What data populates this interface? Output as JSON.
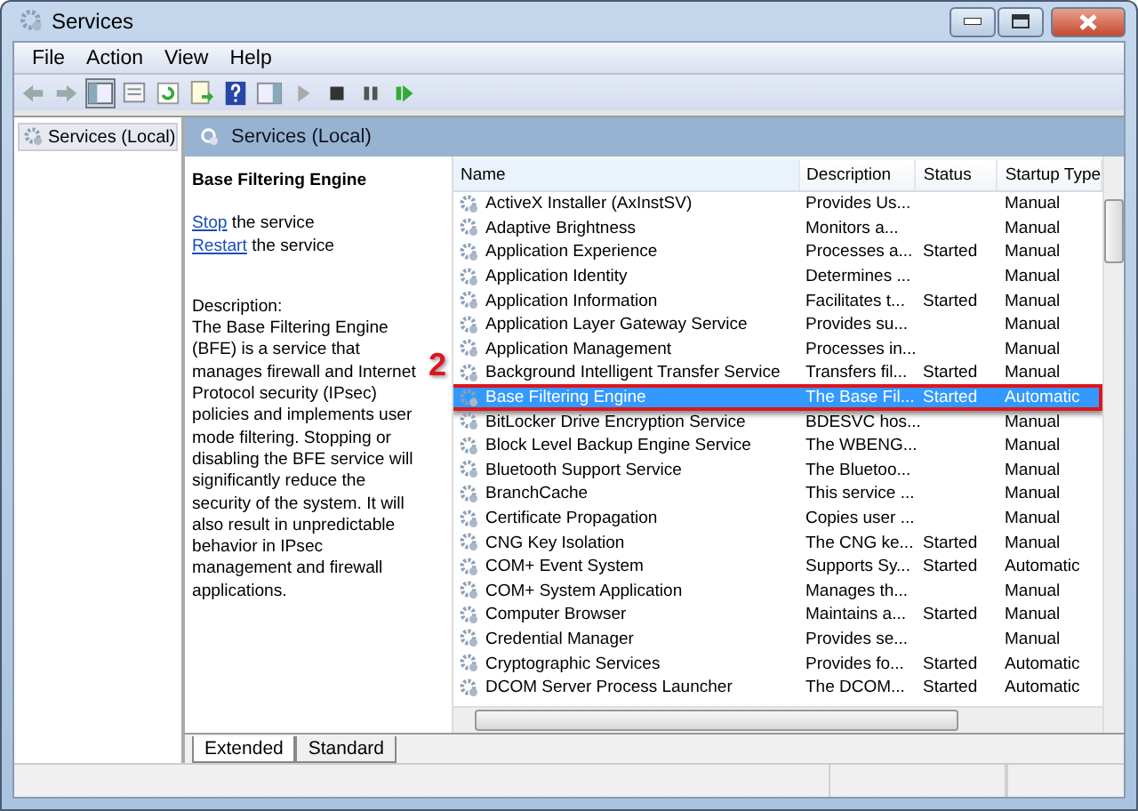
{
  "window": {
    "title": "Services"
  },
  "menu": [
    "File",
    "Action",
    "View",
    "Help"
  ],
  "tree": {
    "items": [
      {
        "label": "Services (Local)",
        "selected": true
      }
    ]
  },
  "pane_header": "Services (Local)",
  "details": {
    "title": "Base Filtering Engine",
    "actions": [
      {
        "link": "Stop",
        "text": "the service"
      },
      {
        "link": "Restart",
        "text": "the service"
      }
    ],
    "description_label": "Description:",
    "description": "The Base Filtering Engine (BFE) is a service that manages firewall and Internet Protocol security (IPsec) policies and implements user mode filtering. Stopping or disabling the BFE service will significantly reduce the security of the system. It will also result in unpredictable behavior in IPsec management and firewall applications."
  },
  "table": {
    "columns": [
      "Name",
      "Description",
      "Status",
      "Startup Type"
    ],
    "rows": [
      {
        "name": "ActiveX Installer (AxInstSV)",
        "description": "Provides Us...",
        "status": "",
        "startup": "Manual",
        "selected": false
      },
      {
        "name": "Adaptive Brightness",
        "description": "Monitors a...",
        "status": "",
        "startup": "Manual",
        "selected": false
      },
      {
        "name": "Application Experience",
        "description": "Processes a...",
        "status": "Started",
        "startup": "Manual",
        "selected": false
      },
      {
        "name": "Application Identity",
        "description": "Determines ...",
        "status": "",
        "startup": "Manual",
        "selected": false
      },
      {
        "name": "Application Information",
        "description": "Facilitates t...",
        "status": "Started",
        "startup": "Manual",
        "selected": false
      },
      {
        "name": "Application Layer Gateway Service",
        "description": "Provides su...",
        "status": "",
        "startup": "Manual",
        "selected": false
      },
      {
        "name": "Application Management",
        "description": "Processes in...",
        "status": "",
        "startup": "Manual",
        "selected": false
      },
      {
        "name": "Background Intelligent Transfer Service",
        "description": "Transfers fil...",
        "status": "Started",
        "startup": "Manual",
        "selected": false
      },
      {
        "name": "Base Filtering Engine",
        "description": "The Base Fil...",
        "status": "Started",
        "startup": "Automatic",
        "selected": true
      },
      {
        "name": "BitLocker Drive Encryption Service",
        "description": "BDESVC hos...",
        "status": "",
        "startup": "Manual",
        "selected": false
      },
      {
        "name": "Block Level Backup Engine Service",
        "description": "The WBENG...",
        "status": "",
        "startup": "Manual",
        "selected": false
      },
      {
        "name": "Bluetooth Support Service",
        "description": "The Bluetoo...",
        "status": "",
        "startup": "Manual",
        "selected": false
      },
      {
        "name": "BranchCache",
        "description": "This service ...",
        "status": "",
        "startup": "Manual",
        "selected": false
      },
      {
        "name": "Certificate Propagation",
        "description": "Copies user ...",
        "status": "",
        "startup": "Manual",
        "selected": false
      },
      {
        "name": "CNG Key Isolation",
        "description": "The CNG ke...",
        "status": "Started",
        "startup": "Manual",
        "selected": false
      },
      {
        "name": "COM+ Event System",
        "description": "Supports Sy...",
        "status": "Started",
        "startup": "Automatic",
        "selected": false
      },
      {
        "name": "COM+ System Application",
        "description": "Manages th...",
        "status": "",
        "startup": "Manual",
        "selected": false
      },
      {
        "name": "Computer Browser",
        "description": "Maintains a...",
        "status": "Started",
        "startup": "Manual",
        "selected": false
      },
      {
        "name": "Credential Manager",
        "description": "Provides se...",
        "status": "",
        "startup": "Manual",
        "selected": false
      },
      {
        "name": "Cryptographic Services",
        "description": "Provides fo...",
        "status": "Started",
        "startup": "Automatic",
        "selected": false
      },
      {
        "name": "DCOM Server Process Launcher",
        "description": "The DCOM...",
        "status": "Started",
        "startup": "Automatic",
        "selected": false
      }
    ]
  },
  "annotation": {
    "label": "2"
  },
  "tabs": [
    {
      "label": "Extended",
      "selected": true
    },
    {
      "label": "Standard",
      "selected": false
    }
  ]
}
